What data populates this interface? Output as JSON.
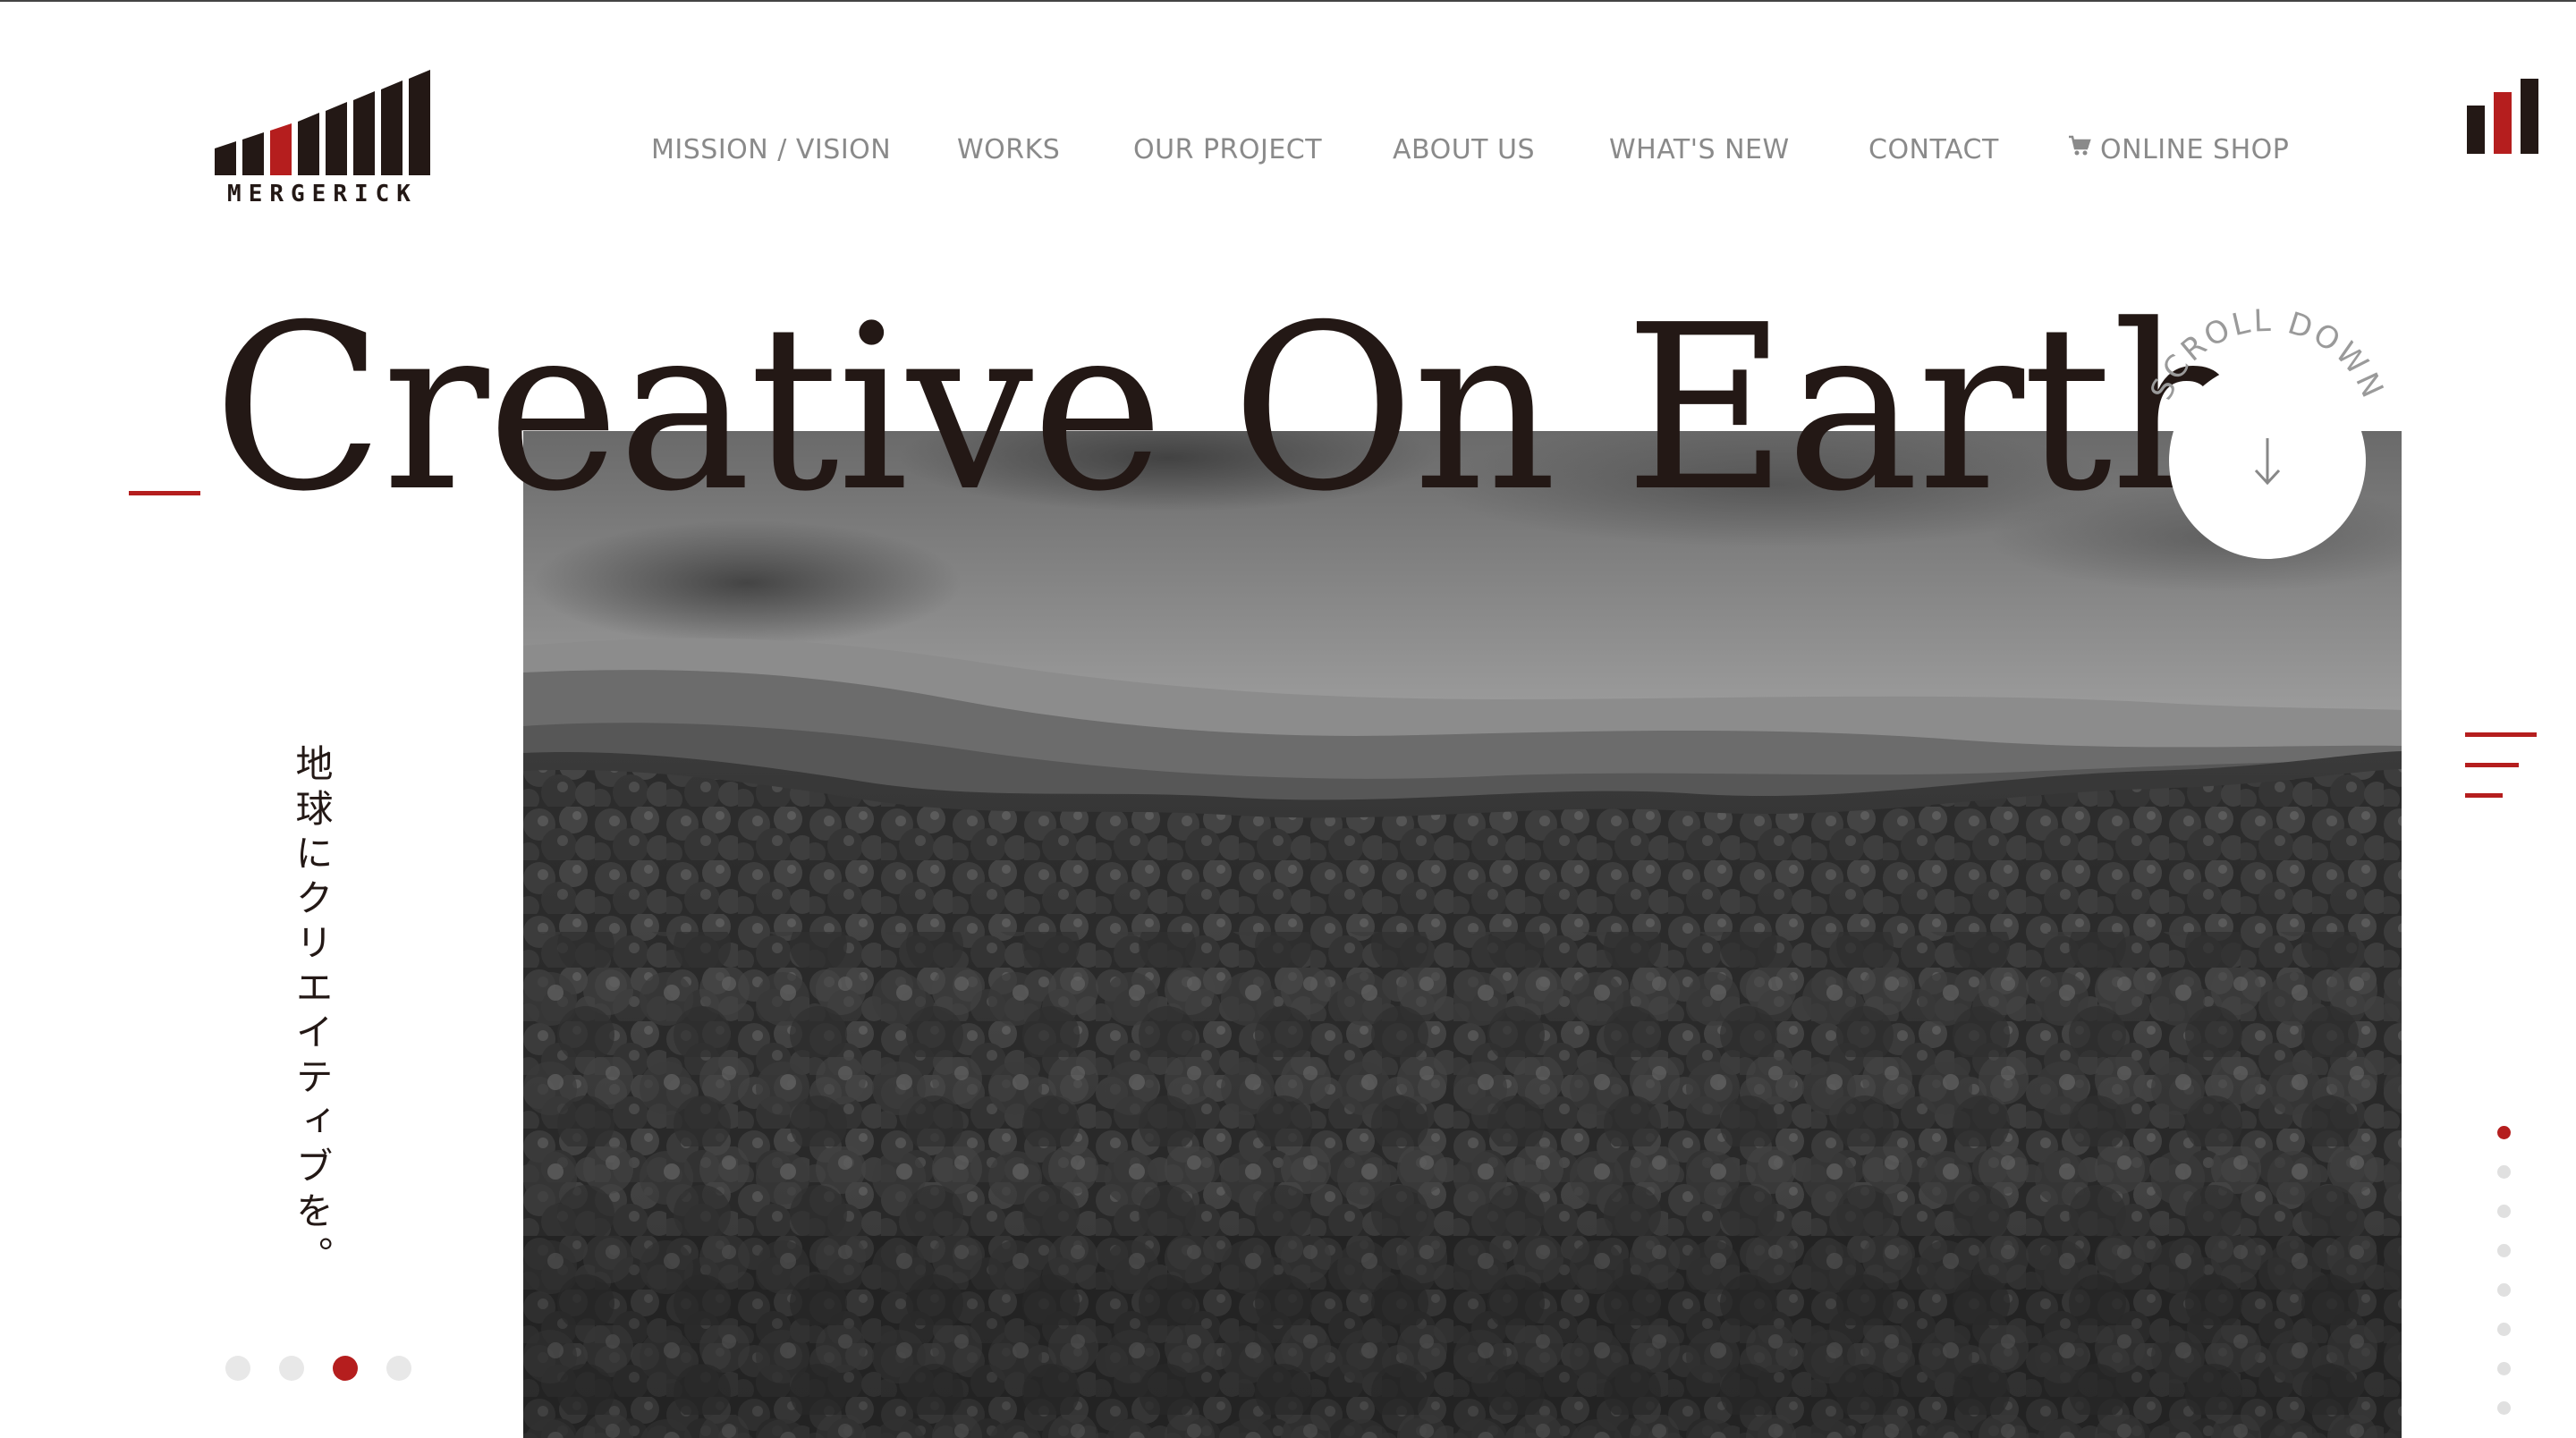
{
  "brand": {
    "name": "MERGERICK",
    "accent_color": "#b51e1e",
    "dark_color": "#231815"
  },
  "nav": {
    "items": [
      {
        "label": "MISSION / VISION"
      },
      {
        "label": "WORKS"
      },
      {
        "label": "OUR PROJECT"
      },
      {
        "label": "ABOUT US"
      },
      {
        "label": "WHAT'S NEW"
      },
      {
        "label": "CONTACT"
      },
      {
        "label": "ONLINE SHOP",
        "icon": "cart-icon"
      }
    ]
  },
  "hero": {
    "headline": "Creative On Earth",
    "tagline_jp": "地球にクリエイティブを。",
    "scroll_label": "SCROLL DOWN",
    "scroll_icon": "arrow-down-icon",
    "image": "black-and-white-forest-landscape"
  },
  "slider": {
    "count": 4,
    "active_index": 2
  },
  "section_nav": {
    "count": 8,
    "active_index": 0
  },
  "menu_icon": "hamburger-menu-icon"
}
